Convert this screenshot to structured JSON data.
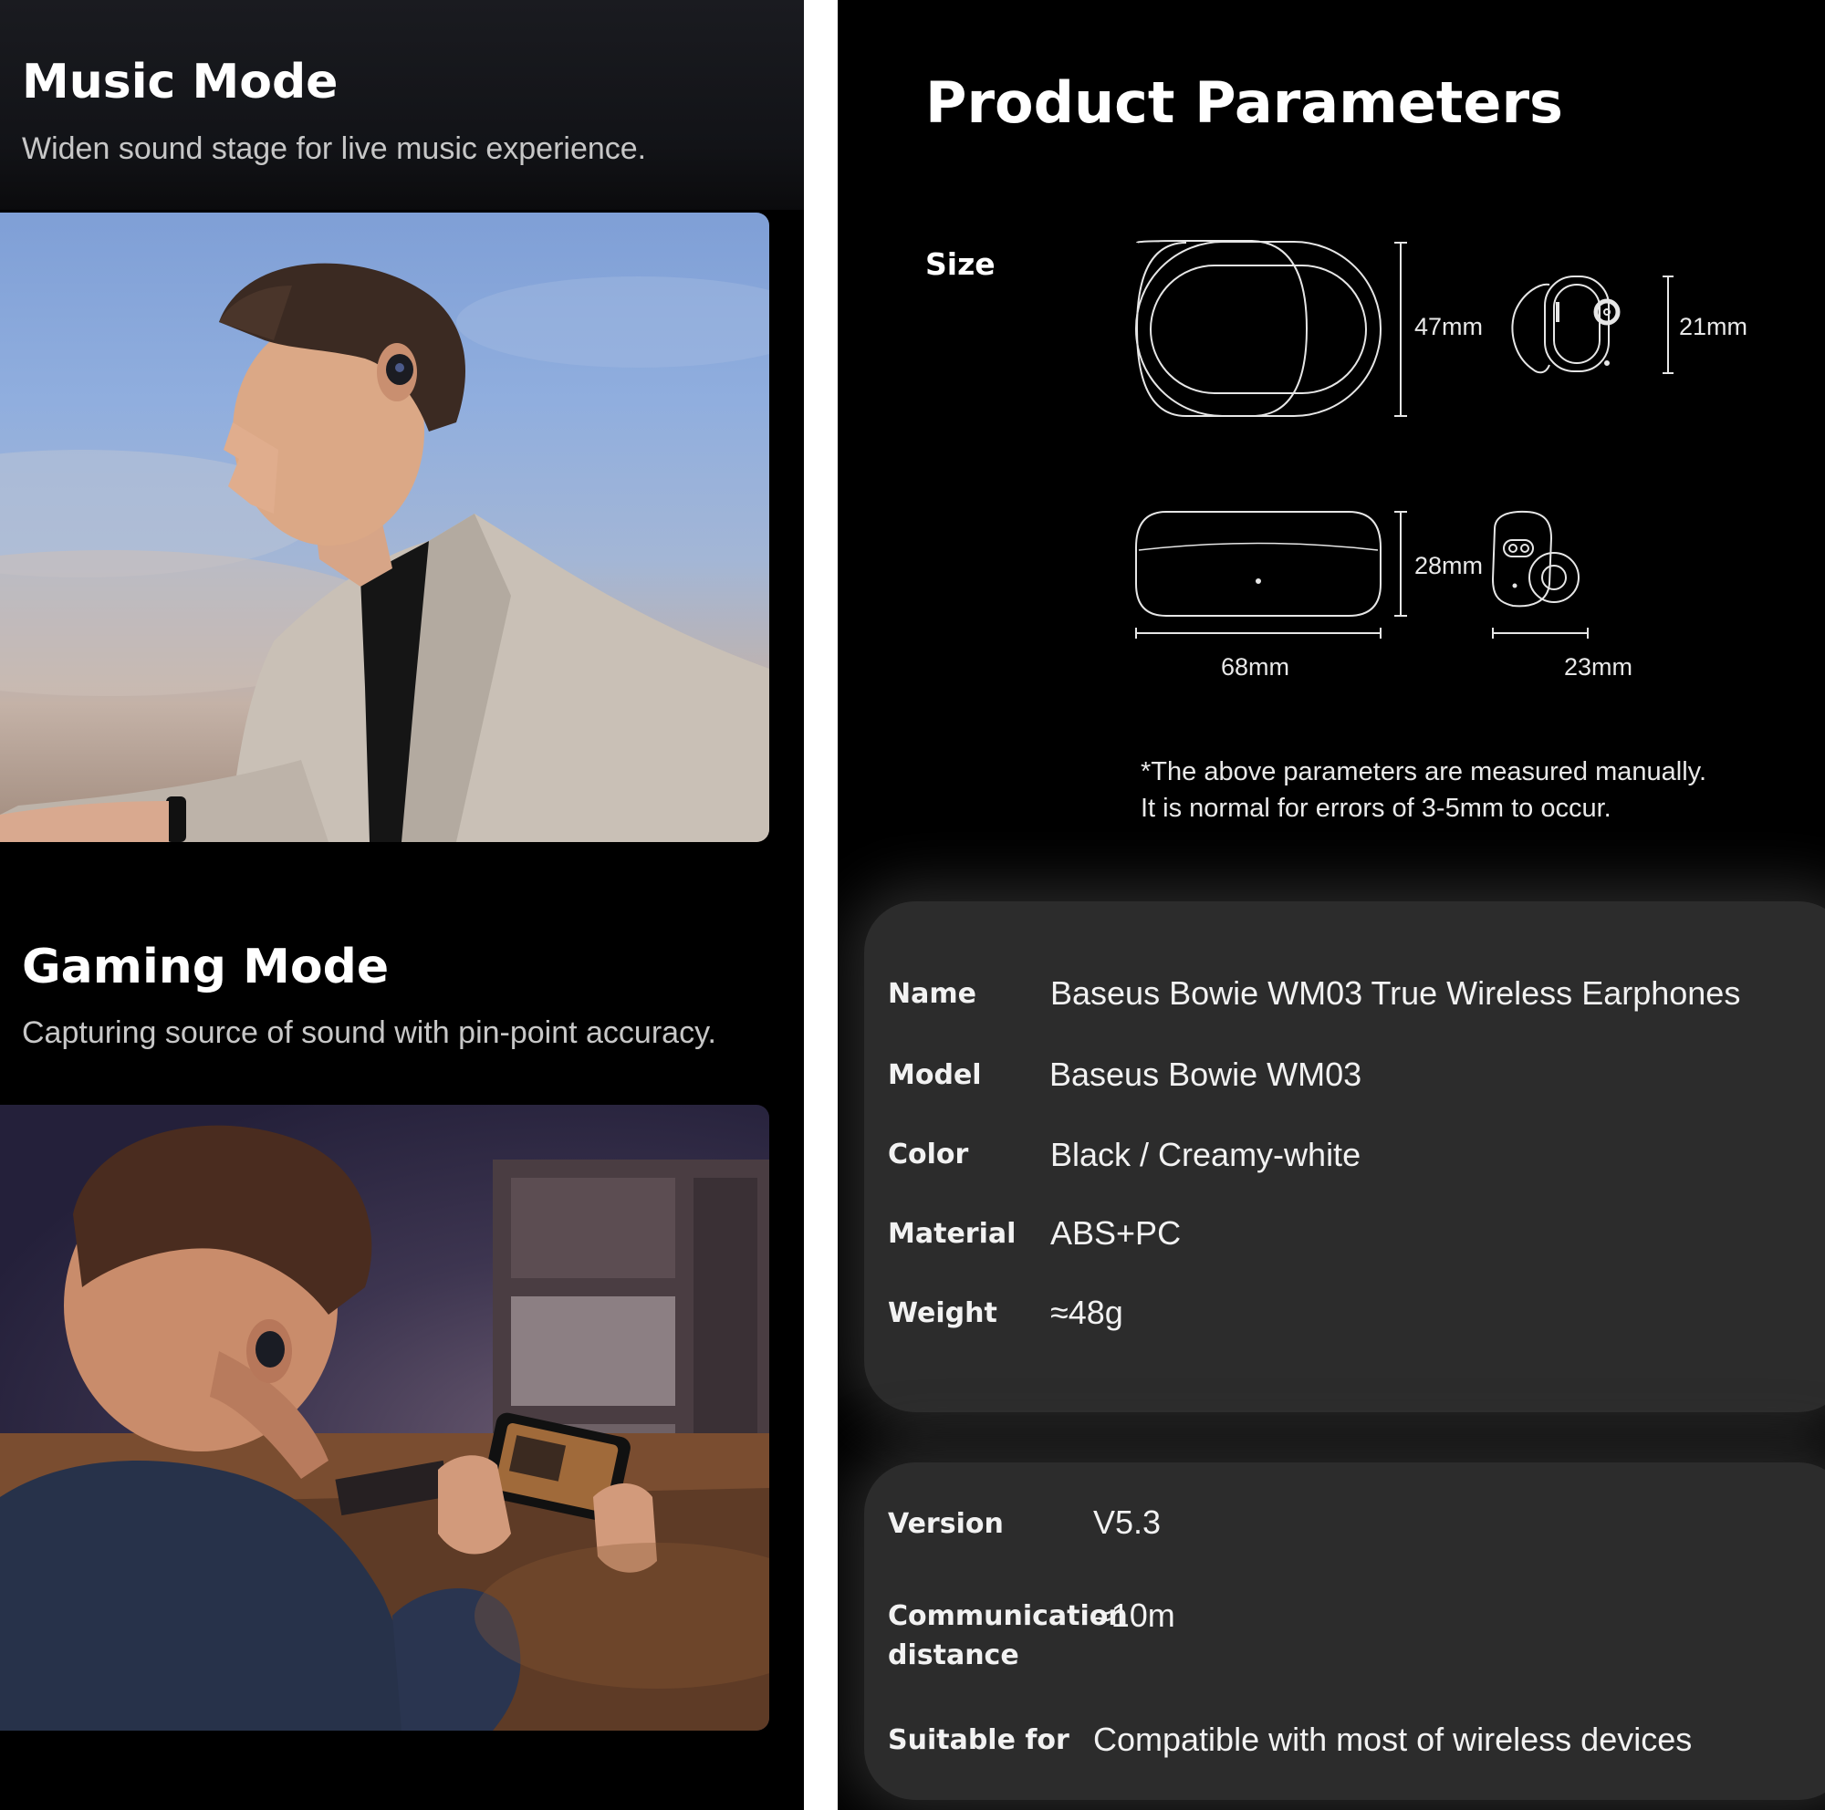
{
  "music_mode": {
    "title": "Music Mode",
    "subtitle": "Widen sound stage for live music experience."
  },
  "gaming_mode": {
    "title": "Gaming Mode",
    "subtitle": "Capturing source of sound with pin-point accuracy."
  },
  "params": {
    "title": "Product Parameters",
    "size_label": "Size",
    "dimensions": {
      "case_height": "47mm",
      "earbud_height": "21mm",
      "case_depth": "28mm",
      "case_width": "68mm",
      "earbud_width": "23mm"
    },
    "note_line1": "*The above parameters are measured manually.",
    "note_line2": "It is normal for errors of 3-5mm to occur."
  },
  "specs": [
    {
      "label": "Name",
      "value": "Baseus Bowie WM03 True Wireless Earphones"
    },
    {
      "label": "Model",
      "value": "Baseus Bowie WM03"
    },
    {
      "label": "Color",
      "value": "Black / Creamy-white"
    },
    {
      "label": "Material",
      "value": "ABS+PC"
    },
    {
      "label": "Weight",
      "value": "≈48g"
    }
  ],
  "specs2": [
    {
      "label": "Version",
      "value": "V5.3"
    },
    {
      "label_line1": "Communication",
      "label_line2": "distance",
      "value": "≈10m"
    },
    {
      "label": "Suitable for",
      "value": "Compatible with most of wireless devices"
    }
  ],
  "colors": {
    "background": "#000000",
    "card": "#2c2c2c",
    "subtitle": "#c7c7c7"
  }
}
